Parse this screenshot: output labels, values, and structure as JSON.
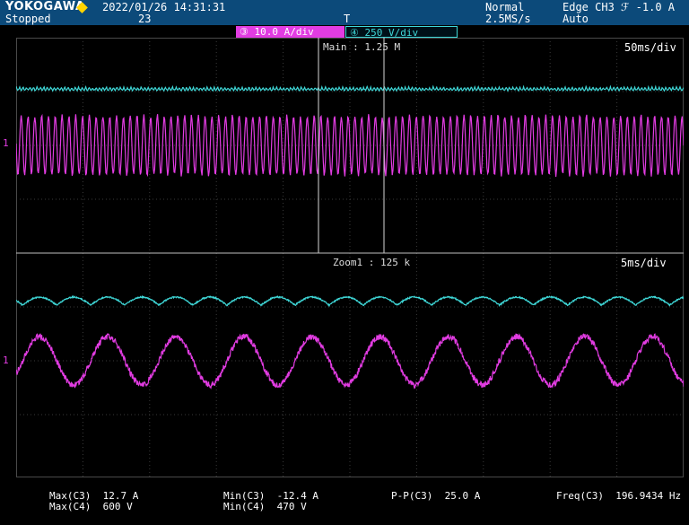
{
  "header": {
    "brand": "YOKOGAWA",
    "status": "Stopped",
    "date_time": "2022/01/26 14:31:31",
    "acq_count": "23",
    "mode": "Normal",
    "sample_rate": "2.5MS/s",
    "trigger": "Edge CH3 ℱ -1.0 A",
    "trigger_mode": "Auto",
    "trigger_icon": "T"
  },
  "channels": {
    "ch3_label": "③ 10.0 A/div",
    "ch4_label": "④ 250 V/div",
    "ch3_color": "#e23ce2",
    "ch4_color": "#3fd8d8"
  },
  "main_window": {
    "label": "Main : 1.25 M",
    "timebase": "50ms/div"
  },
  "zoom_window": {
    "label": "Zoom1 : 125 k",
    "timebase": "5ms/div"
  },
  "measurements": {
    "max_c3": "Max(C3)  12.7 A",
    "max_c4": "Max(C4)  600 V",
    "min_c3": "Min(C3)  -12.4 A",
    "min_c4": "Min(C4)  470 V",
    "pp_c3": "P-P(C3)  25.0 A",
    "freq_c3": "Freq(C3)  196.9434 Hz"
  },
  "ground_marker": "1"
}
